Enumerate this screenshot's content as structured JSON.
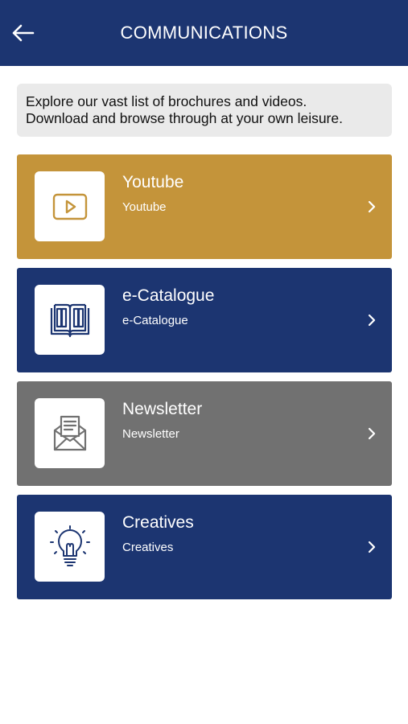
{
  "header": {
    "title": "COMMUNICATIONS",
    "back_icon": "arrow-left-icon",
    "background": "#1c3571"
  },
  "intro": {
    "line1": "Explore our vast list of brochures and videos.",
    "line2": "Download and browse through at your own leisure."
  },
  "items": [
    {
      "title": "Youtube",
      "subtitle": "Youtube",
      "icon": "play-video-icon",
      "color": "#c4943a"
    },
    {
      "title": "e-Catalogue",
      "subtitle": "e-Catalogue",
      "icon": "open-book-icon",
      "color": "#1c3571"
    },
    {
      "title": "Newsletter",
      "subtitle": "Newsletter",
      "icon": "envelope-letter-icon",
      "color": "#717171"
    },
    {
      "title": "Creatives",
      "subtitle": "Creatives",
      "icon": "lightbulb-icon",
      "color": "#1c3571"
    }
  ]
}
